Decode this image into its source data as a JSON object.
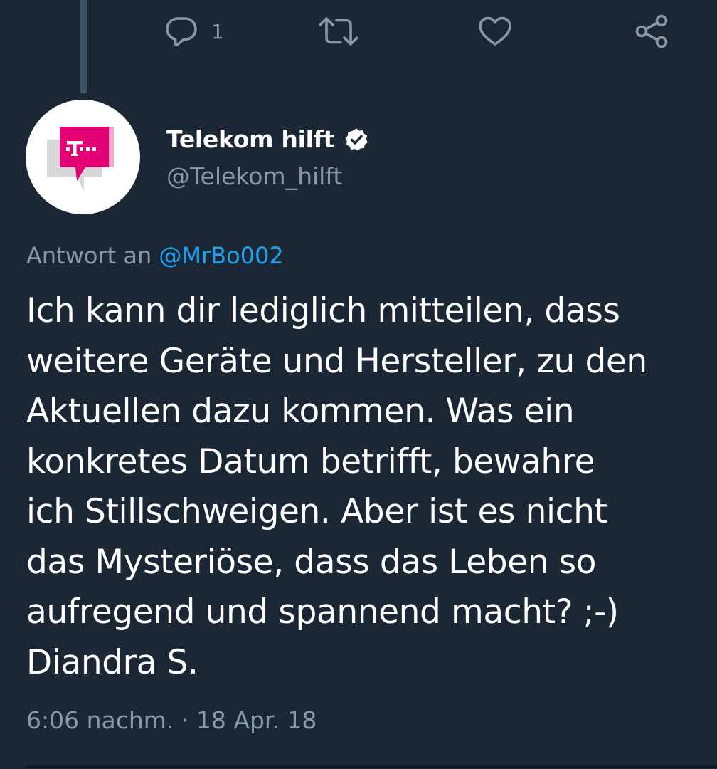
{
  "previous_tweet_actions": {
    "reply_count": "1",
    "reply_icon": "speech-bubble",
    "retweet_icon": "retweet-arrows",
    "like_icon": "heart",
    "share_icon": "share-nodes"
  },
  "tweet": {
    "avatar_icon": "telekom-logo-speech-bubbles",
    "display_name": "Telekom hilft",
    "verified_icon": "verified-badge",
    "handle": "@Telekom_hilft",
    "reply_to_prefix": "Antwort an",
    "reply_to_mention": "@MrBo002",
    "text": "Ich kann dir lediglich mitteilen, dass\nweitere Geräte und Hersteller, zu den\nAktuellen dazu kommen. Was ein\nkonkretes Datum betrifft, bewahre\nich Stillschweigen. Aber ist es nicht\ndas Mysteriöse, dass das Leben so\naufregend und spannend macht? ;-)\nDiandra S.",
    "timestamp": "6:06 nachm. · 18 Apr. 18"
  },
  "colors": {
    "background": "#1c2735",
    "text_primary": "#ffffff",
    "text_secondary": "#8899a6",
    "link": "#1da1f2",
    "brand_magenta": "#e20074",
    "thread_line": "#3d5466"
  }
}
